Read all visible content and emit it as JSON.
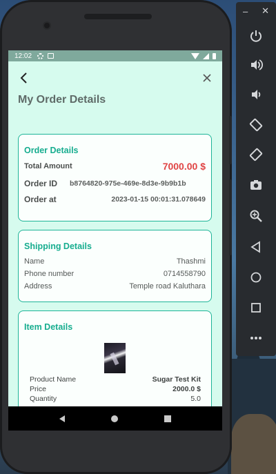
{
  "status_bar": {
    "time": "12:02",
    "icons": [
      "gear-icon",
      "image-icon",
      "wifi-icon",
      "signal-icon",
      "battery-icon"
    ]
  },
  "header": {
    "back_icon": "arrow-back-icon",
    "close_icon": "close-icon",
    "title": "My Order Details"
  },
  "order_details": {
    "title": "Order Details",
    "total_amount_label": "Total Amount",
    "total_amount_value": "7000.00 $",
    "order_id_label": "Order ID",
    "order_id_value": "b8764820-975e-469e-8d3e-9b9b1b",
    "order_at_label": "Order at",
    "order_at_value": "2023-01-15 00:01:31.078649"
  },
  "shipping_details": {
    "title": "Shipping Details",
    "rows": [
      {
        "label": "Name",
        "value": "Thashmi"
      },
      {
        "label": "Phone number",
        "value": "0714558790"
      },
      {
        "label": "Address",
        "value": "Temple road Kaluthara"
      }
    ]
  },
  "item_details": {
    "title": "Item Details",
    "rows": [
      {
        "label": "Product Name",
        "value": "Sugar Test Kit"
      },
      {
        "label": "Price",
        "value": "2000.0 $"
      },
      {
        "label": "Quantity",
        "value": "5.0"
      }
    ]
  },
  "nav_bar": {
    "icons": [
      "nav-back-icon",
      "nav-home-icon",
      "nav-recent-icon"
    ]
  },
  "emulator_panel": {
    "minimize": "–",
    "close": "✕",
    "tools": [
      "power-icon",
      "volume-up-icon",
      "volume-down-icon",
      "rotate-left-icon",
      "rotate-right-icon",
      "camera-icon",
      "zoom-icon",
      "back-icon",
      "home-icon",
      "overview-icon",
      "more-icon"
    ]
  },
  "colors": {
    "accent": "#17ad8f",
    "amount": "#e04444",
    "screen_bg": "#d6fbee"
  }
}
